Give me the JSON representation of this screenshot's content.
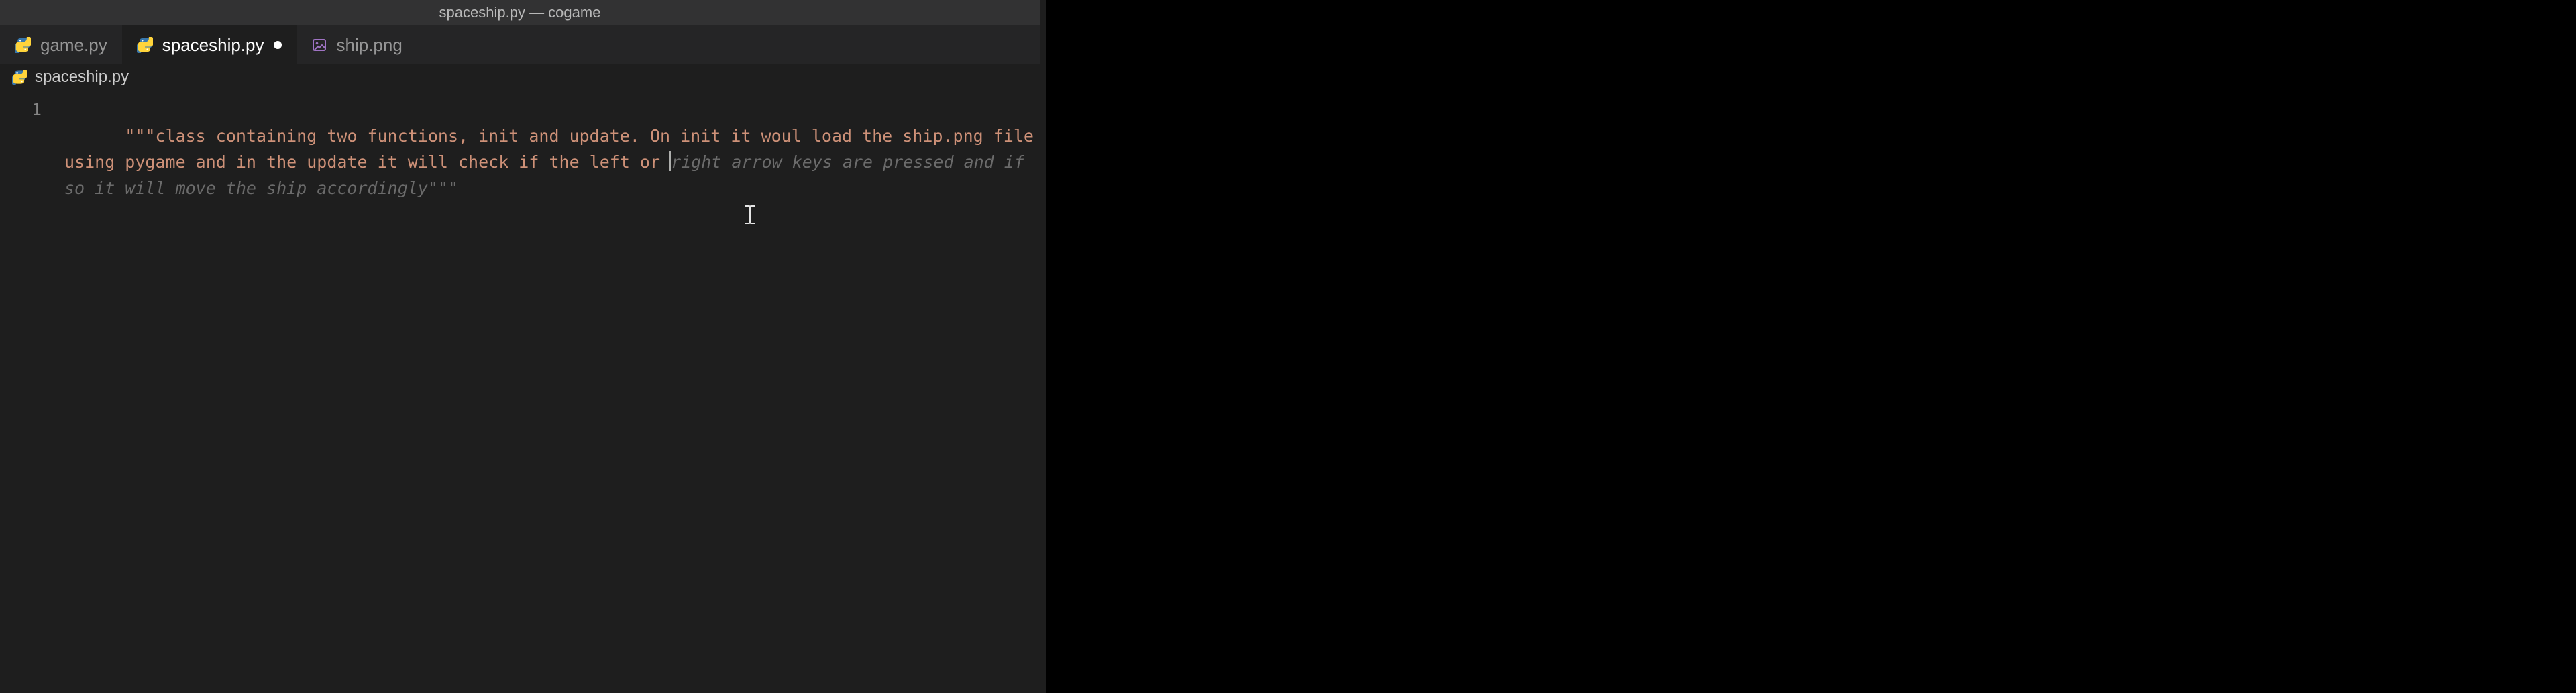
{
  "window": {
    "title": "spaceship.py — cogame"
  },
  "tabs": [
    {
      "label": "game.py",
      "icon": "python",
      "active": false,
      "dirty": false
    },
    {
      "label": "spaceship.py",
      "icon": "python",
      "active": true,
      "dirty": true
    },
    {
      "label": "ship.png",
      "icon": "image",
      "active": false,
      "dirty": false
    }
  ],
  "breadcrumb": {
    "icon": "python",
    "file": "spaceship.py"
  },
  "editor": {
    "line_numbers": [
      "1"
    ],
    "typed_text": "\"\"\"class containing two functions, init and update. On init it woul load the ship.png file using pygame and in the update it will check if the left or ",
    "ghost_text": "right arrow keys are pressed and if so it will move the ship accordingly\"\"\""
  }
}
